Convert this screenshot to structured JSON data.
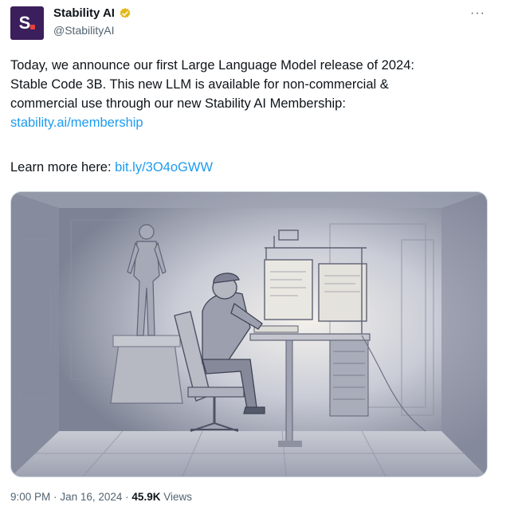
{
  "author": {
    "display_name": "Stability AI",
    "handle": "@StabilityAI",
    "avatar_letter": "S",
    "avatar_bg": "#3b1e5c",
    "avatar_dot_color": "#e8413a",
    "verified_icon": "verified-gold-badge-icon",
    "verified_color": "#e2b719"
  },
  "more_icon": "more-horizontal-icon",
  "tweet": {
    "line1": "Today, we announce our first Large Language Model release of 2024:",
    "line2": "Stable Code 3B. This new LLM is available for non-commercial &",
    "line3": "commercial use through our new Stability AI Membership:",
    "membership_link": "stability.ai/membership",
    "learn_more_label": "Learn more here: ",
    "learn_more_link": "bit.ly/3O4oGWW"
  },
  "media": {
    "icon": "illustration-person-coding-at-desk-image"
  },
  "footer": {
    "time": "9:00 PM",
    "date": "Jan 16, 2024",
    "separator": "·",
    "views_count": "45.9K",
    "views_label": "Views"
  },
  "colors": {
    "link": "#1d9bf0",
    "secondary_text": "#536471",
    "primary_text": "#0f1419"
  }
}
